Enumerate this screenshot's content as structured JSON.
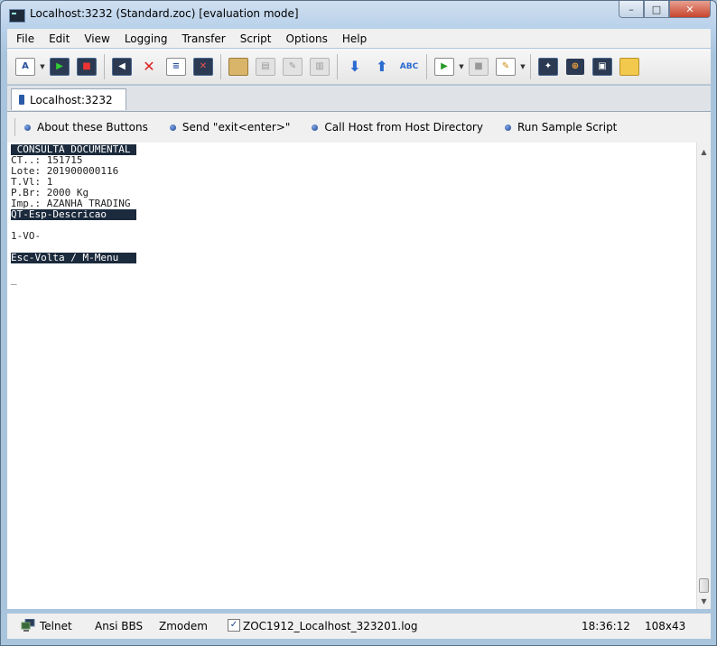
{
  "window": {
    "title": "Localhost:3232 (Standard.zoc) [evaluation mode]",
    "caption_minimize": "–",
    "caption_maximize": "□",
    "caption_close": "✕"
  },
  "menu": {
    "items": [
      "File",
      "Edit",
      "View",
      "Logging",
      "Transfer",
      "Script",
      "Options",
      "Help"
    ]
  },
  "toolbar": {
    "icons": [
      "font-icon",
      "connect-icon",
      "disconnect-icon",
      "send-file-icon",
      "cancel-icon",
      "session-icon",
      "close-session-icon",
      "paste-icon",
      "copy-icon",
      "edit-icon",
      "clipboard-icon",
      "download-icon",
      "upload-icon",
      "spellcheck-icon",
      "run-script-icon",
      "stop-icon",
      "script-edit-icon",
      "terminal-settings-icon",
      "host-directory-icon",
      "new-window-icon",
      "folder-icon"
    ],
    "abc_label": "ABC"
  },
  "tabs": {
    "active_label": "Localhost:3232"
  },
  "buttonbar": {
    "items": [
      "About these Buttons",
      "Send \"exit<enter>\"",
      "Call Host from Host Directory",
      "Run Sample Script"
    ]
  },
  "terminal": {
    "lines": [
      {
        "text": " CONSULTA DOCUMENTAL ",
        "inverse": true
      },
      {
        "text": "CT..: 151715",
        "inverse": false
      },
      {
        "text": "Lote: 201900000116",
        "inverse": false
      },
      {
        "text": "T.Vl: 1",
        "inverse": false
      },
      {
        "text": "P.Br: 2000 Kg",
        "inverse": false
      },
      {
        "text": "Imp.: AZANHA TRADING",
        "inverse": false
      },
      {
        "text": "QT-Esp-Descricao     ",
        "inverse": true
      },
      {
        "text": "",
        "inverse": false
      },
      {
        "text": "1-VO-",
        "inverse": false
      },
      {
        "text": "",
        "inverse": false
      },
      {
        "text": "Esc-Volta / M-Menu   ",
        "inverse": true
      },
      {
        "text": "",
        "inverse": false
      },
      {
        "text": "_",
        "inverse": false
      }
    ]
  },
  "statusbar": {
    "protocol": "Telnet",
    "emulation": "Ansi BBS",
    "transfer": "Zmodem",
    "log_checked": "✓",
    "log_file": "ZOC1912_Localhost_323201.log",
    "time": "18:36:12",
    "size": "108x43"
  }
}
